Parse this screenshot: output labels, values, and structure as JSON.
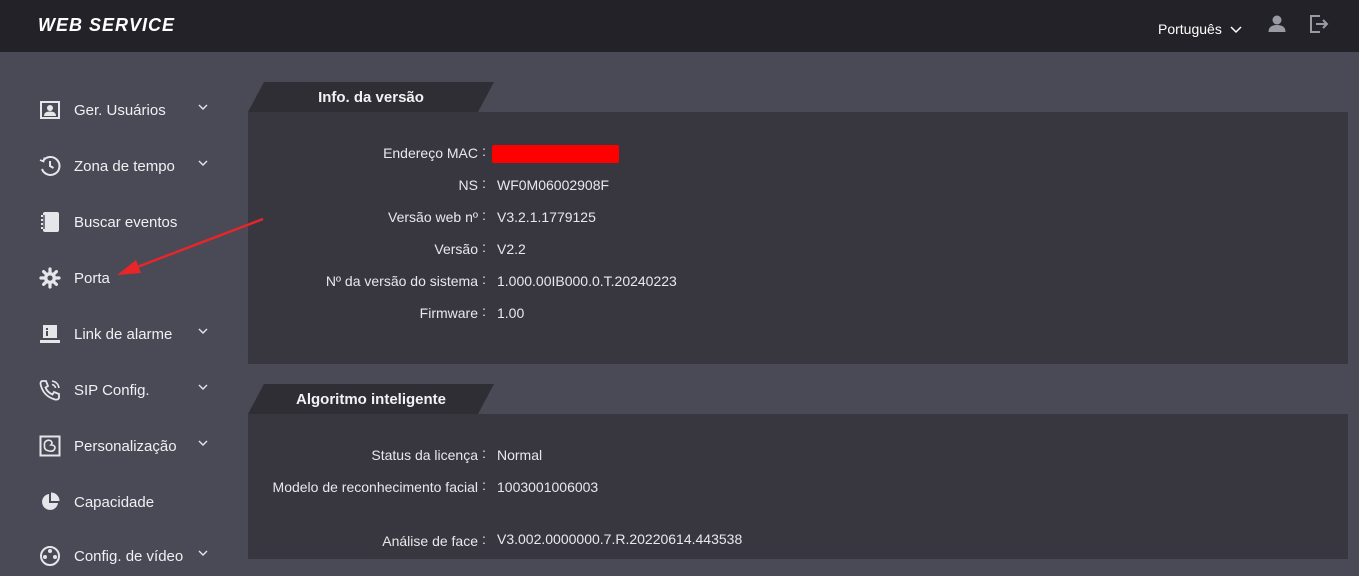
{
  "header": {
    "title": "WEB SERVICE",
    "language": "Português",
    "user_icon": "user-icon",
    "logout_icon": "logout-icon"
  },
  "sidebar": {
    "items": [
      {
        "label": "Ger. Usuários",
        "icon": "user-card-icon",
        "expandable": true
      },
      {
        "label": "Zona de tempo",
        "icon": "clock-history-icon",
        "expandable": true
      },
      {
        "label": "Buscar eventos",
        "icon": "notebook-icon",
        "expandable": false
      },
      {
        "label": "Porta",
        "icon": "gear-icon",
        "expandable": false
      },
      {
        "label": "Link de alarme",
        "icon": "alarm-device-icon",
        "expandable": true
      },
      {
        "label": "SIP Config.",
        "icon": "phone-icon",
        "expandable": true
      },
      {
        "label": "Personalização",
        "icon": "palette-icon",
        "expandable": true
      },
      {
        "label": "Capacidade",
        "icon": "pie-chart-icon",
        "expandable": false
      },
      {
        "label": "Config. de vídeo",
        "icon": "video-icon",
        "expandable": true
      }
    ]
  },
  "version_info": {
    "title": "Info. da versão",
    "rows": [
      {
        "label": "Endereço MAC",
        "value": "",
        "redacted": true
      },
      {
        "label": "NS",
        "value": "WF0M06002908F"
      },
      {
        "label": "Versão web nº",
        "value": "V3.2.1.1779125"
      },
      {
        "label": "Versão",
        "value": "V2.2"
      },
      {
        "label": "Nº da versão do sistema",
        "value": "1.000.00IB000.0.T.20240223"
      },
      {
        "label": "Firmware",
        "value": "1.00"
      }
    ]
  },
  "smart_algorithm": {
    "title": "Algoritmo inteligente",
    "rows": [
      {
        "label": "Status da licença",
        "value": "Normal"
      },
      {
        "label": "Modelo de reconhecimento facial",
        "value": "1003001006003"
      },
      {
        "label": "Análise de face",
        "value": "V3.002.0000000.7.R.20220614.443538"
      }
    ]
  },
  "colors": {
    "topbar": "#232228",
    "background": "#4a4956",
    "panel": "#38373f",
    "annotation_arrow": "#e8262a",
    "redaction": "#ff0000"
  },
  "annotation": {
    "type": "arrow",
    "points_to": "Porta"
  }
}
